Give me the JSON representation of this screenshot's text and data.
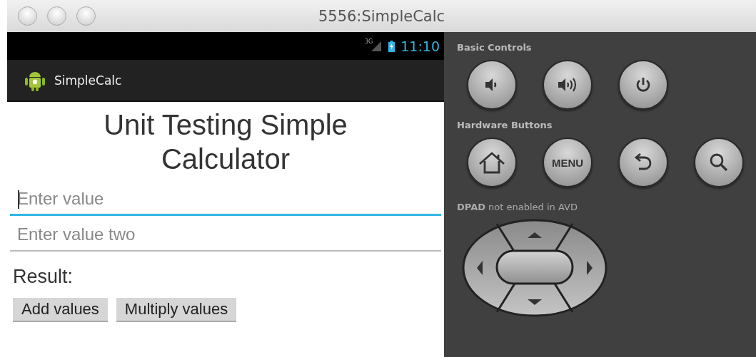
{
  "window": {
    "title": "5556:SimpleCalc"
  },
  "status_bar": {
    "network": "3G",
    "time": "11:10"
  },
  "action_bar": {
    "title": "SimpleCalc"
  },
  "heading": "Unit Testing Simple Calculator",
  "fields": [
    {
      "placeholder": "Enter value",
      "focused": true
    },
    {
      "placeholder": "Enter value two",
      "focused": false
    }
  ],
  "result_label": "Result:",
  "buttons": [
    "Add values",
    "Multiply values"
  ],
  "controls": {
    "basic_label": "Basic Controls",
    "basic": [
      {
        "kind": "volume-down"
      },
      {
        "kind": "volume-up"
      },
      {
        "kind": "power"
      }
    ],
    "hardware_label": "Hardware Buttons",
    "hardware": [
      {
        "kind": "home"
      },
      {
        "kind": "menu",
        "label": "MENU"
      },
      {
        "kind": "back"
      },
      {
        "kind": "search"
      }
    ],
    "dpad_note": "**DPAD** not enabled in AVD"
  }
}
